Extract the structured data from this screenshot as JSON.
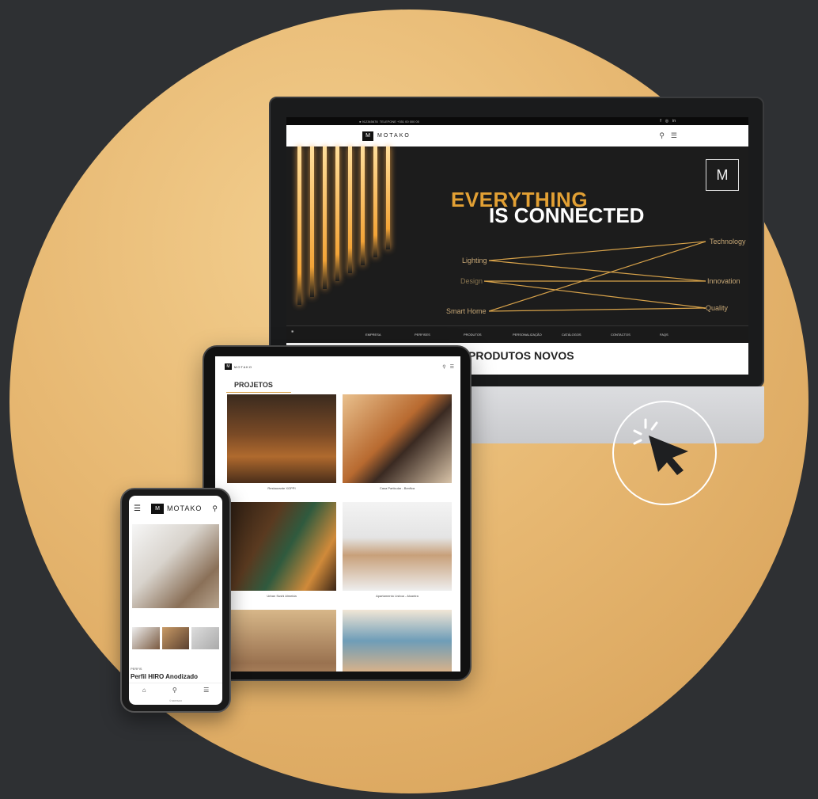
{
  "brand": {
    "name": "MOTAKO",
    "logo_glyph": "M"
  },
  "desktop": {
    "topbar": {
      "contact_left": "● 912345678",
      "contact_right": "TELEFONE +351 00 000 00",
      "social": [
        "f",
        "◎",
        "in"
      ]
    },
    "hero": {
      "line1": "EVERYTHING",
      "line2": "IS CONNECTED",
      "keywords_left": [
        "Lighting",
        "Design",
        "Smart Home"
      ],
      "keywords_right": [
        "Technology",
        "Innovation",
        "Quality"
      ]
    },
    "nav": [
      "EMPRESA",
      "PERFISES",
      "PRODUTOS",
      "PERSONALIZAÇÃO",
      "CATÁLOGOS",
      "CONTACTOS",
      "FAQS"
    ],
    "section_title": "PRODUTOS NOVOS"
  },
  "tablet": {
    "section_title": "PROJETOS",
    "projects": [
      {
        "caption": "Restaurante XOPPI"
      },
      {
        "caption": "Casa Particular - Benfica"
      },
      {
        "caption": "Urban Sushi Almeida"
      },
      {
        "caption": "Apartamento Lisboa - Alcantra"
      },
      {
        "caption": ""
      },
      {
        "caption": ""
      }
    ]
  },
  "phone": {
    "product_category": "PERFIS",
    "product_name": "Perfil HIRO Anodizado",
    "footer": "© MOTAKO",
    "bottom_nav": [
      "home-icon",
      "search-icon",
      "menu-icon"
    ]
  },
  "colors": {
    "accent": "#e2a034",
    "background": "#2e3033",
    "circle": "#e7b872"
  }
}
